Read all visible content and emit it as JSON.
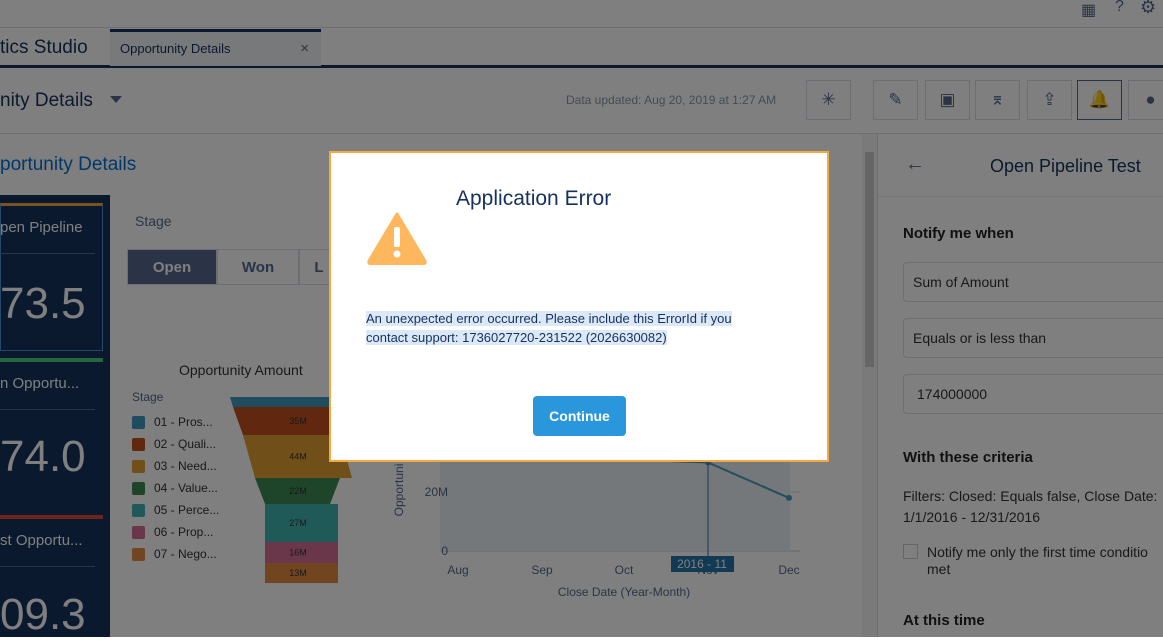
{
  "app": {
    "title": "tics Studio",
    "tab_label": "Opportunity Details",
    "tab_close": "×"
  },
  "toolbar": {
    "dashboard_title": "nity Details",
    "data_updated": "Data updated: Aug 20, 2019 at 1:27 AM"
  },
  "main": {
    "heading": "portunity Details",
    "kpis": [
      {
        "label": "pen Pipeline",
        "value": "73.5"
      },
      {
        "label": "n Opportu...",
        "value": "74.0"
      },
      {
        "label": "st Opportu...",
        "value": "09.3"
      }
    ],
    "stage_label": "Stage",
    "stage_buttons": [
      "Open",
      "Won",
      "L"
    ],
    "funnel": {
      "title": "Opportunity Amount",
      "legend_title": "Stage",
      "legend": [
        {
          "label": "01 - Pros...",
          "color": "#3e9bbf"
        },
        {
          "label": "02 - Quali...",
          "color": "#c2501f"
        },
        {
          "label": "03 - Need...",
          "color": "#e0a030"
        },
        {
          "label": "04 - Value...",
          "color": "#3d8a55"
        },
        {
          "label": "05 - Perce...",
          "color": "#3fb3b0"
        },
        {
          "label": "06 - Prop...",
          "color": "#d46c94"
        },
        {
          "label": "07 - Nego...",
          "color": "#e08a3e"
        }
      ],
      "values": [
        "35M",
        "44M",
        "22M",
        "27M",
        "16M",
        "13M"
      ]
    }
  },
  "chart_data": {
    "type": "line",
    "xlabel": "Close Date (Year-Month)",
    "ylabel": "Opportuni",
    "categories": [
      "Aug",
      "Sep",
      "Oct",
      "Nov",
      "Dec"
    ],
    "y_ticks": [
      "0",
      "20M"
    ],
    "visible_points": [
      {
        "x": "Nov",
        "y": 30
      },
      {
        "x": "Dec",
        "y": 18
      }
    ],
    "unit": "M",
    "tooltip": "2016 - 11"
  },
  "right_panel": {
    "title": "Open Pipeline Test",
    "notify_heading": "Notify me when",
    "measure": "Sum of Amount",
    "operator": "Equals or is less than",
    "threshold": "174000000",
    "criteria_heading": "With these criteria",
    "filters_line1": "Filters: Closed: Equals false, Close Date:",
    "filters_line2": "1/1/2016 - 12/31/2016",
    "checkbox_label": "Notify me only the first time conditio",
    "checkbox_label2": "met",
    "time_heading": "At this time"
  },
  "modal": {
    "title": "Application Error",
    "message_line1": "An unexpected error occurred. Please include this ErrorId if you",
    "message_line2": "contact support: 1736027720-231522 (2026630082)",
    "continue_label": "Continue",
    "accent": "#f4a940"
  }
}
